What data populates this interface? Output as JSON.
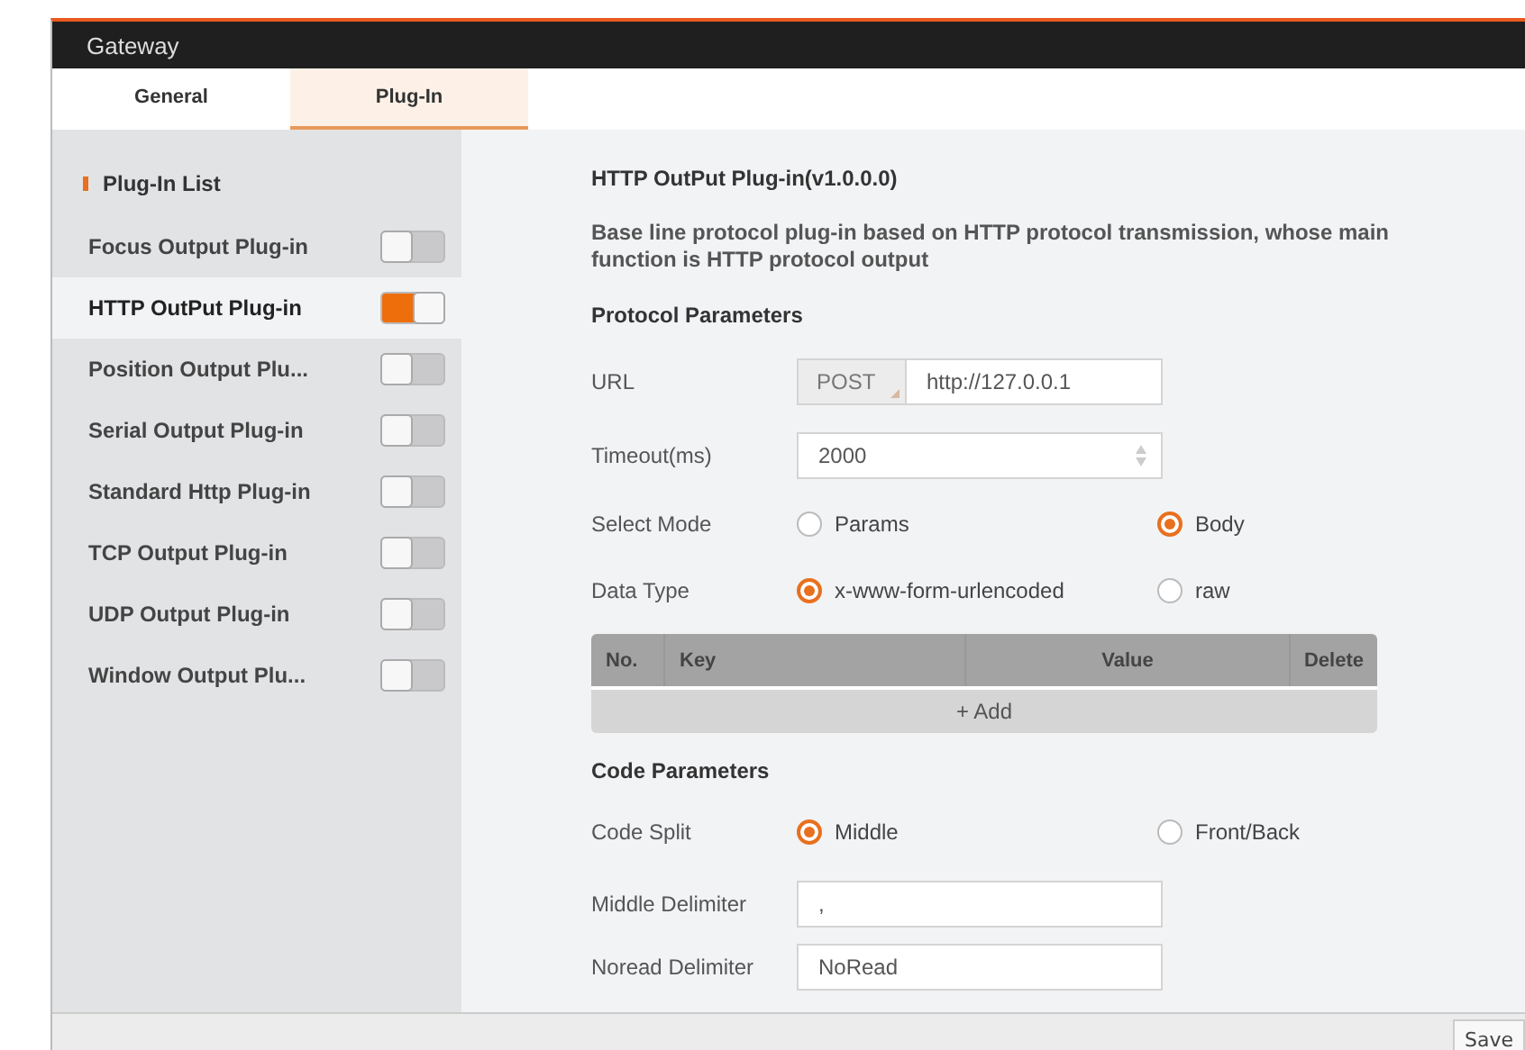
{
  "window": {
    "title": "Gateway"
  },
  "tabs": [
    {
      "label": "General",
      "selected": false
    },
    {
      "label": "Plug-In",
      "selected": true
    }
  ],
  "sidebar": {
    "title": "Plug-In List",
    "items": [
      {
        "label": "Focus Output Plug-in",
        "on": false,
        "selected": false
      },
      {
        "label": "HTTP OutPut Plug-in",
        "on": true,
        "selected": true
      },
      {
        "label": "Position Output Plu...",
        "on": false,
        "selected": false
      },
      {
        "label": "Serial Output Plug-in",
        "on": false,
        "selected": false
      },
      {
        "label": "Standard Http Plug-in",
        "on": false,
        "selected": false
      },
      {
        "label": "TCP Output Plug-in",
        "on": false,
        "selected": false
      },
      {
        "label": "UDP Output Plug-in",
        "on": false,
        "selected": false
      },
      {
        "label": "Window Output Plu...",
        "on": false,
        "selected": false
      }
    ]
  },
  "content": {
    "title": "HTTP OutPut Plug-in(v1.0.0.0)",
    "description": "Base line protocol plug-in based on HTTP protocol transmission, whose main function is HTTP protocol output",
    "sections": [
      {
        "heading": "Protocol Parameters",
        "rows": [
          {
            "kind": "url",
            "label": "URL",
            "method": "POST",
            "value": "http://127.0.0.1"
          },
          {
            "kind": "spinner",
            "label": "Timeout(ms)",
            "value": "2000"
          },
          {
            "kind": "radio",
            "label": "Select Mode",
            "options": [
              {
                "label": "Params",
                "selected": false
              },
              {
                "label": "Body",
                "selected": true
              }
            ]
          },
          {
            "kind": "radio",
            "label": "Data Type",
            "options": [
              {
                "label": "x-www-form-urlencoded",
                "selected": true
              },
              {
                "label": "raw",
                "selected": false
              }
            ]
          },
          {
            "kind": "table",
            "columns": [
              "No.",
              "Key",
              "Value",
              "Delete"
            ],
            "add_button": "+ Add"
          }
        ]
      },
      {
        "heading": "Code Parameters",
        "rows": [
          {
            "kind": "radio",
            "label": "Code Split",
            "options": [
              {
                "label": "Middle",
                "selected": true
              },
              {
                "label": "Front/Back",
                "selected": false
              }
            ]
          },
          {
            "kind": "text",
            "label": "Middle Delimiter",
            "value": ","
          },
          {
            "kind": "text",
            "label": "Noread Delimiter",
            "value": "NoRead"
          }
        ]
      }
    ]
  },
  "footer": {
    "save_button": "Save"
  }
}
